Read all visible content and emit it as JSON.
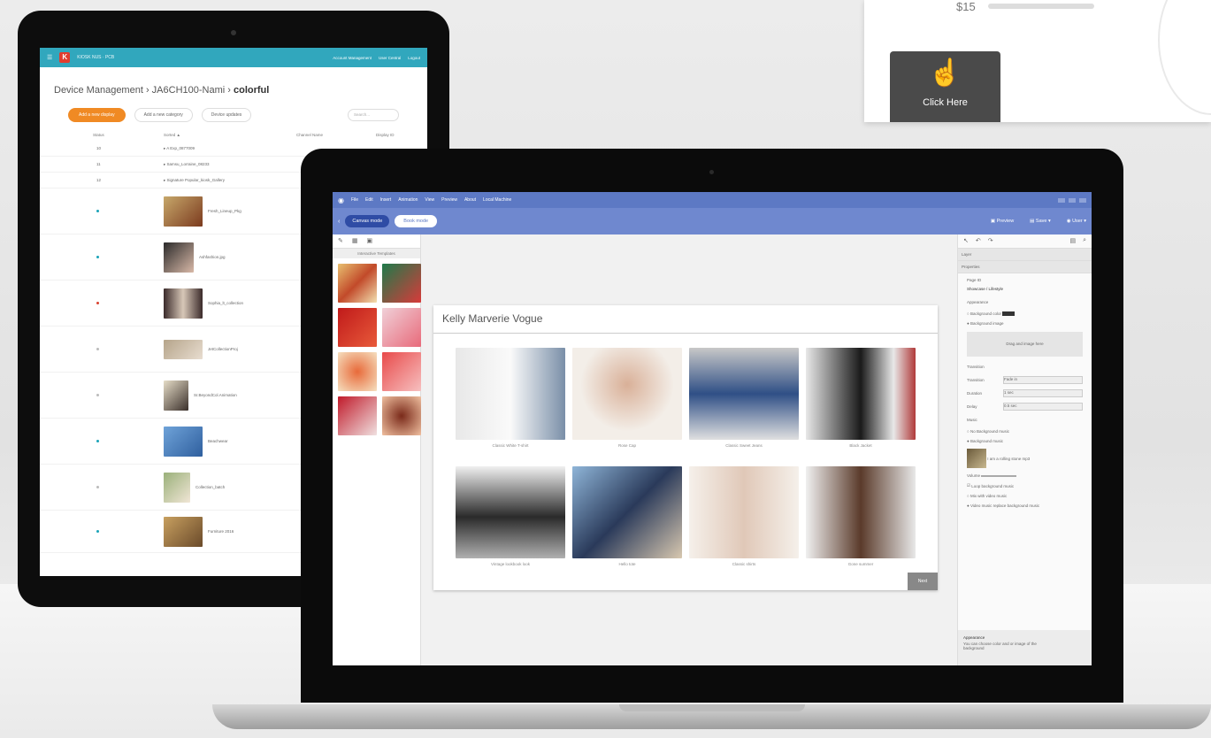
{
  "kiosk": {
    "price": "$15",
    "button_label": "Click Here",
    "hand_icon": "pointer-hand-icon"
  },
  "tablet": {
    "header": {
      "brand": "KIOSK NUS · PCB",
      "links": [
        "Account Management",
        "User Central",
        "Logout"
      ]
    },
    "breadcrumb": {
      "part1": "Device Management",
      "part2": "JA6CH100-Nami",
      "current": "colorful"
    },
    "toolbar": {
      "primary": "Add a new display",
      "btn2": "Add a new category",
      "btn3": "Device updates",
      "search_placeholder": "Search..."
    },
    "columns": [
      "Status",
      "Sorted ▲",
      "Channel Name",
      "Display ID"
    ],
    "rows": [
      {
        "id": "10",
        "name": "▸ A Exp_0877009"
      },
      {
        "id": "11",
        "name": "▸ Samsu_Lorraine_08233"
      },
      {
        "id": "12",
        "name": "▸ Signature Popular_kiosk_Gallery"
      },
      {
        "name": "Fresh_Lineup_Pkg",
        "dot": "#1aa3b8"
      },
      {
        "name": "Ashfashion.jpg",
        "dot": "#1aa3b8"
      },
      {
        "name": "Sophia_lt_collection",
        "dot": "#d9412f"
      },
      {
        "name": "JetCollectionProj",
        "dot": "#bbb"
      },
      {
        "name": "Sr.BeyondCol.Animation",
        "dot": "#bbb"
      },
      {
        "name": "Beachwear",
        "dot": "#1aa3b8"
      },
      {
        "name": "Collection_batch",
        "dot": "#bbb"
      },
      {
        "name": "Furniture 2016",
        "dot": "#1aa3b8"
      }
    ]
  },
  "laptop": {
    "menu": [
      "File",
      "Edit",
      "Insert",
      "Animation",
      "View",
      "Preview",
      "About",
      "Local Machine"
    ],
    "toolbar": {
      "canvas_mode": "Canvas mode",
      "alt_mode": "Book mode",
      "preview": "Preview",
      "save": "Save",
      "user": "User"
    },
    "left_panel": {
      "title": "Interactive Templates"
    },
    "canvas": {
      "title": "Kelly Marverie Vogue",
      "captions": [
        "Classic White T-shirt",
        "Rose Cap",
        "Classic Sweet Jeans",
        "Black Jacket",
        "Vintage lookbook look",
        "Hello tote",
        "Classic shirts",
        "Gone summer"
      ],
      "next_label": "Next"
    },
    "right_panel": {
      "sections": [
        "Layer",
        "Properties"
      ],
      "page_id_label": "Page ID",
      "page_id_value": "Showcase / Lifestyle",
      "appearance": "Appearance",
      "bg_color": "Background color",
      "bg_image": "Background image",
      "drop": "Drag and image here",
      "transition_title": "Transition",
      "transition": "Transition",
      "transition_val": "Fade in",
      "duration": "Duration",
      "duration_val": "1 sec",
      "delay": "Delay",
      "delay_val": "0.5 sec",
      "music": "Music",
      "no_music": "No Background music",
      "bg_music": "Background music",
      "music_file": "I am a rolling stone mp3",
      "volume": "Volume",
      "loop": "Loop background music",
      "mix": "Mix with video music",
      "replace": "Video music replace background music",
      "footer_title": "Appearance",
      "footer_text": "You can choose color and or image of the background"
    }
  }
}
